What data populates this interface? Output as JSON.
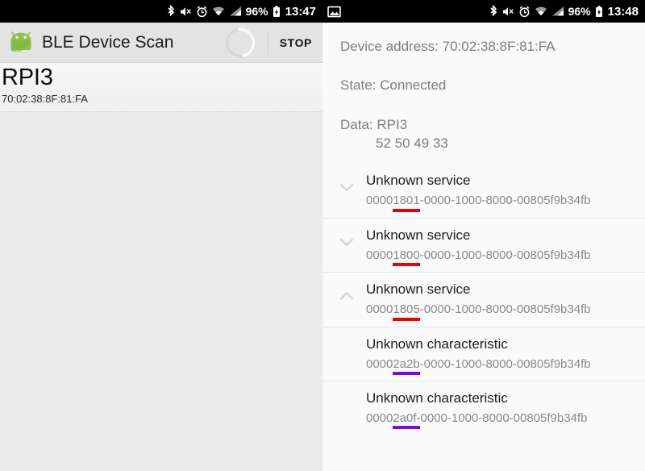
{
  "left": {
    "statusbar": {
      "icons": [
        "bluetooth-icon",
        "volume-mute-icon",
        "alarm-icon",
        "wifi-icon",
        "cellular-signal-icon"
      ],
      "battery_percent": "96%",
      "battery_icon": "battery-icon",
      "time": "13:47"
    },
    "appbar": {
      "logo": "android-robot-icon",
      "title": "BLE Device Scan",
      "spinner": "scanning-spinner",
      "stop_label": "STOP"
    },
    "devices": [
      {
        "name": "RPI3",
        "address": "70:02:38:8F:81:FA"
      }
    ]
  },
  "right": {
    "statusbar": {
      "left_icons": [
        "image-icon"
      ],
      "icons": [
        "bluetooth-icon",
        "volume-mute-icon",
        "alarm-icon",
        "wifi-icon",
        "cellular-signal-icon"
      ],
      "battery_percent": "96%",
      "battery_icon": "battery-icon",
      "time": "13:48"
    },
    "info": {
      "device_address": "Device address: 70:02:38:8F:81:FA",
      "state": "State: Connected",
      "data": "Data: RPI3",
      "data_hex": "52 50 49 33"
    },
    "colors": {
      "service_underline": "#f20000",
      "characteristic_underline": "#7b06f0"
    },
    "gatt": [
      {
        "title": "Unknown service",
        "uuid": "00001801-0000-1000-8000-00805f9b34fb",
        "chevron": "chevron-down-icon",
        "kind": "service"
      },
      {
        "title": "Unknown service",
        "uuid": "00001800-0000-1000-8000-00805f9b34fb",
        "chevron": "chevron-down-icon",
        "kind": "service"
      },
      {
        "title": "Unknown service",
        "uuid": "00001805-0000-1000-8000-00805f9b34fb",
        "chevron": "chevron-up-icon",
        "kind": "service"
      },
      {
        "title": "Unknown characteristic",
        "uuid": "00002a2b-0000-1000-8000-00805f9b34fb",
        "chevron": "",
        "kind": "characteristic"
      },
      {
        "title": "Unknown characteristic",
        "uuid": "00002a0f-0000-1000-8000-00805f9b34fb",
        "chevron": "",
        "kind": "characteristic"
      }
    ]
  }
}
